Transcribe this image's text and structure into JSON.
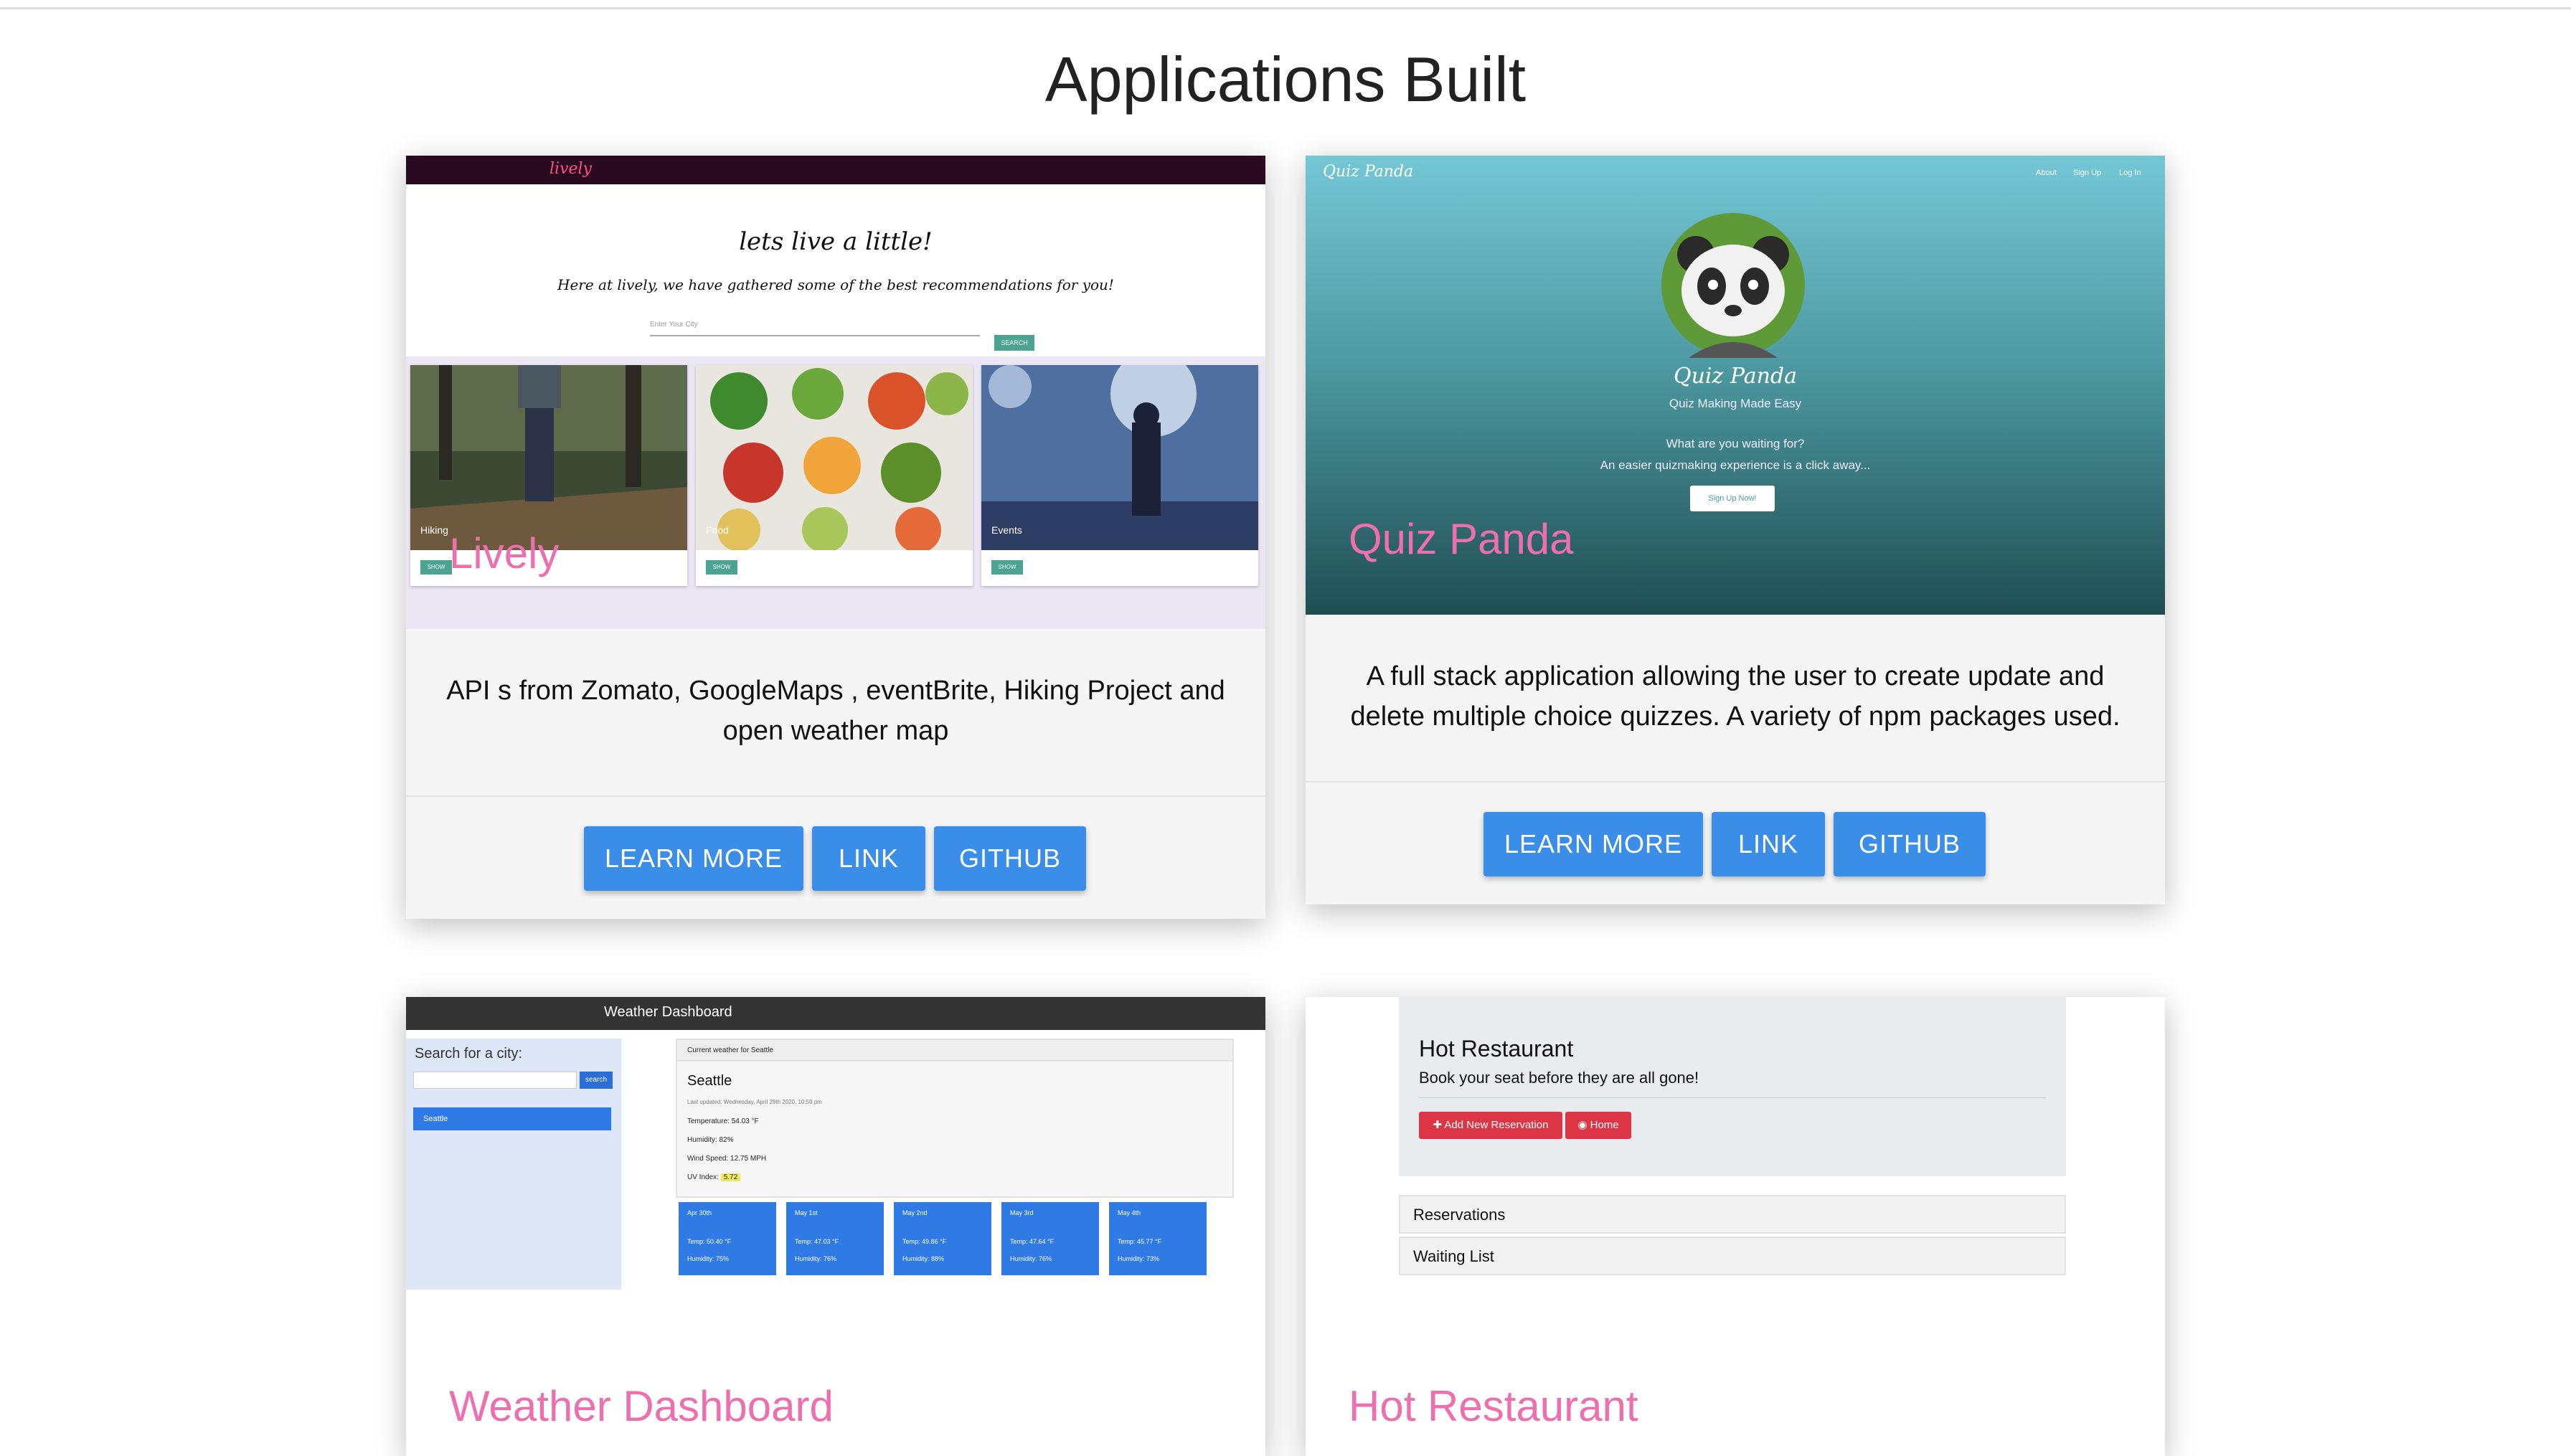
{
  "page": {
    "title": "Applications Built"
  },
  "cards": [
    {
      "title": "Lively",
      "description": "API s from Zomato, GoogleMaps , eventBrite, Hiking Project and open weather map",
      "buttons": [
        "LEARN MORE",
        "LINK",
        "GITHUB"
      ],
      "screenshot": {
        "logo": "lively",
        "headline": "lets live a little!",
        "subheadline": "Here at lively, we have gathered some of the best recommendations for you!",
        "search_placeholder": "Enter Your City",
        "search_button": "SEARCH",
        "tiles": [
          {
            "caption": "Hiking",
            "button": "SHOW"
          },
          {
            "caption": "Food",
            "button": "SHOW"
          },
          {
            "caption": "Events",
            "button": "SHOW"
          }
        ]
      }
    },
    {
      "title": "Quiz Panda",
      "description": "A full stack application allowing the user to create update and delete multiple choice quizzes. A variety of npm packages used.",
      "buttons": [
        "LEARN MORE",
        "LINK",
        "GITHUB"
      ],
      "screenshot": {
        "brand": "Quiz Panda",
        "nav": [
          "About",
          "Sign Up",
          "Log In"
        ],
        "name": "Quiz Panda",
        "tagline": "Quiz Making Made Easy",
        "question": "What are you waiting for?",
        "pitch": "An easier quizmaking experience is a click away...",
        "cta": "Sign Up Now!"
      }
    },
    {
      "title": "Weather Dashboard",
      "screenshot": {
        "header": "Weather Dashboard",
        "search_label": "Search for a city:",
        "search_button": "search",
        "history": [
          "Seattle"
        ],
        "current_header": "Current weather for Seattle",
        "city": "Seattle",
        "updated": "Last updated: Wednesday, April 29th 2020, 10:59 pm",
        "temperature": "Temperature: 54.03 °F",
        "humidity": "Humidity: 82%",
        "wind": "Wind Speed: 12.75 MPH",
        "uv_label": "UV Index:",
        "uv_value": "5.72",
        "forecast": [
          {
            "date": "Apr 30th",
            "temp": "Temp: 50.40 °F",
            "humidity": "Humidity: 75%"
          },
          {
            "date": "May 1st",
            "temp": "Temp: 47.03 °F",
            "humidity": "Humidity: 76%"
          },
          {
            "date": "May 2nd",
            "temp": "Temp: 49.86 °F",
            "humidity": "Humidity: 88%"
          },
          {
            "date": "May 3rd",
            "temp": "Temp: 47.64 °F",
            "humidity": "Humidity: 76%"
          },
          {
            "date": "May 4th",
            "temp": "Temp: 45.77 °F",
            "humidity": "Humidity: 73%"
          }
        ]
      }
    },
    {
      "title": "Hot Restaurant",
      "screenshot": {
        "title": "Hot Restaurant",
        "subtitle": "Book your seat before they are all gone!",
        "buttons": [
          "✚ Add New Reservation",
          "◉ Home"
        ],
        "lists": [
          "Reservations",
          "Waiting List"
        ]
      }
    }
  ],
  "colors": {
    "accent_title": "#ee6fae",
    "button": "#3b8ee8"
  }
}
